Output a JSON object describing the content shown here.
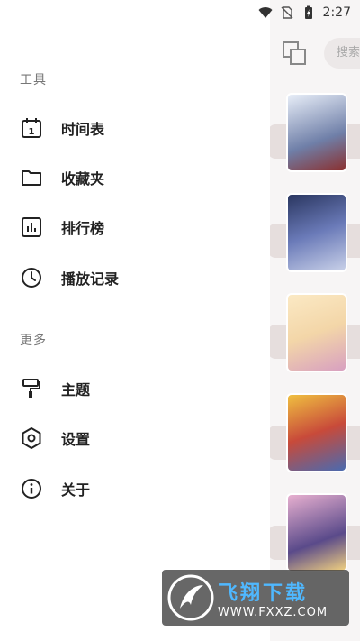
{
  "status_bar": {
    "time": "2:27",
    "icons": [
      "wifi-icon",
      "no-sim-icon",
      "battery-charging-icon"
    ]
  },
  "drawer": {
    "sections": [
      {
        "title": "工具",
        "items": [
          {
            "label": "时间表",
            "icon": "calendar-icon"
          },
          {
            "label": "收藏夹",
            "icon": "folder-icon"
          },
          {
            "label": "排行榜",
            "icon": "bar-chart-icon"
          },
          {
            "label": "播放记录",
            "icon": "clock-icon"
          }
        ]
      },
      {
        "title": "更多",
        "items": [
          {
            "label": "主题",
            "icon": "paint-roller-icon"
          },
          {
            "label": "设置",
            "icon": "settings-hexagon-icon"
          },
          {
            "label": "关于",
            "icon": "info-icon"
          }
        ]
      }
    ]
  },
  "background": {
    "search_placeholder": "搜索",
    "covers": [
      "#6f7fa8",
      "#3a4a7a",
      "#f3d6a8",
      "#c84a3a",
      "#5a4a8a"
    ]
  },
  "watermark": {
    "brand": "飞翔下载",
    "url": "WWW.FXXZ.COM"
  }
}
